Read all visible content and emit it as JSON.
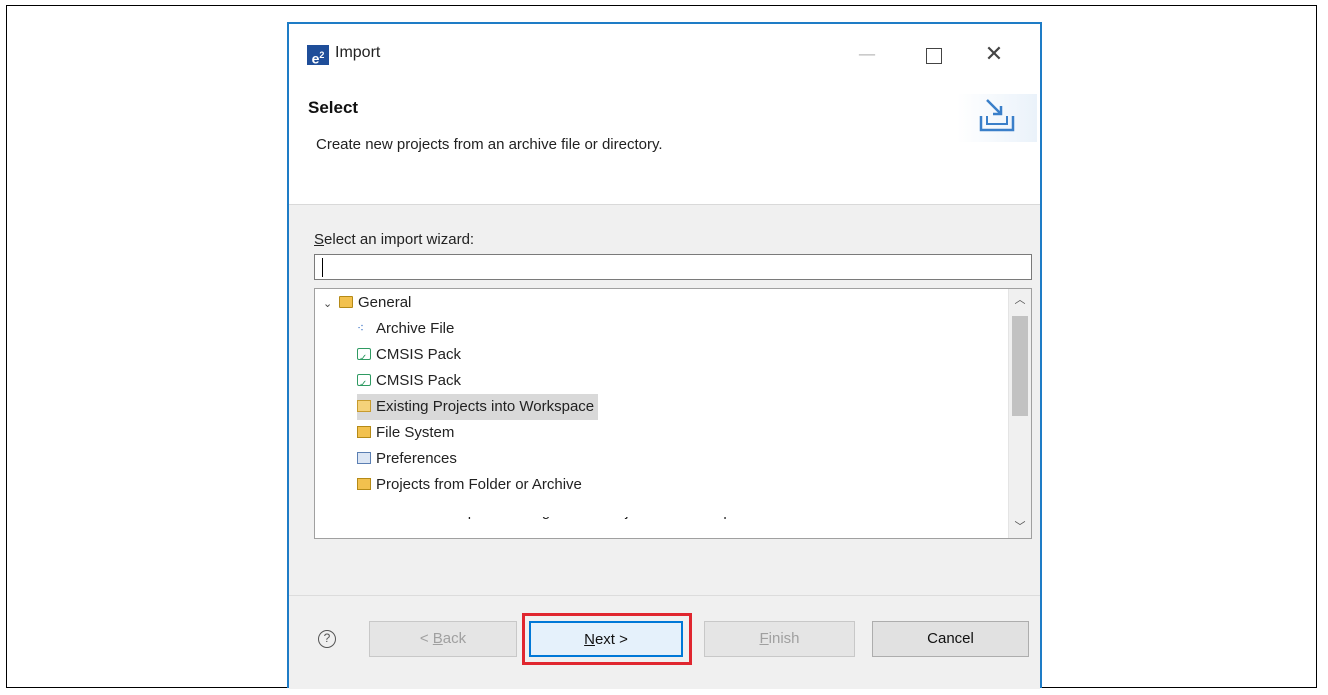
{
  "dialog": {
    "app_icon": "e²",
    "title": "Import",
    "window_controls": [
      "minimize",
      "maximize",
      "close"
    ]
  },
  "header": {
    "title": "Select",
    "description": "Create new projects from an archive file or directory.",
    "banner_icon": "import-wizard-icon"
  },
  "wizard": {
    "label_prefix": "S",
    "label_rest": "elect an import wizard:",
    "filter_value": "",
    "tree": [
      {
        "label": "General",
        "expanded": true,
        "level": 0,
        "icon": "folder-open-icon"
      },
      {
        "label": "Archive File",
        "level": 1,
        "icon": "archive-icon"
      },
      {
        "label": "CMSIS Pack",
        "level": 1,
        "icon": "cmsis-pack-icon"
      },
      {
        "label": "CMSIS Pack",
        "level": 1,
        "icon": "cmsis-pack-icon"
      },
      {
        "label": "Existing Projects into Workspace",
        "level": 1,
        "icon": "existing-projects-icon",
        "selected": true
      },
      {
        "label": "File System",
        "level": 1,
        "icon": "file-system-icon"
      },
      {
        "label": "Preferences",
        "level": 1,
        "icon": "preferences-icon"
      },
      {
        "label": "Projects from Folder or Archive",
        "level": 1,
        "icon": "projects-folder-icon"
      },
      {
        "label": "Rename & Import Existing C/C++ Project into Workspace",
        "level": 1,
        "icon": "rename-import-icon",
        "partially_visible": true
      }
    ]
  },
  "footer": {
    "help": "?",
    "back_prefix": "< ",
    "back_mn": "B",
    "back_rest": "ack",
    "next_mn": "N",
    "next_rest": "ext >",
    "finish_mn": "F",
    "finish_rest": "inish",
    "cancel": "Cancel"
  },
  "colors": {
    "dialog_border": "#1e7cc6",
    "highlight_box": "#e0262f",
    "selection": "#d9d9d9",
    "default_button_border": "#0078d7"
  }
}
